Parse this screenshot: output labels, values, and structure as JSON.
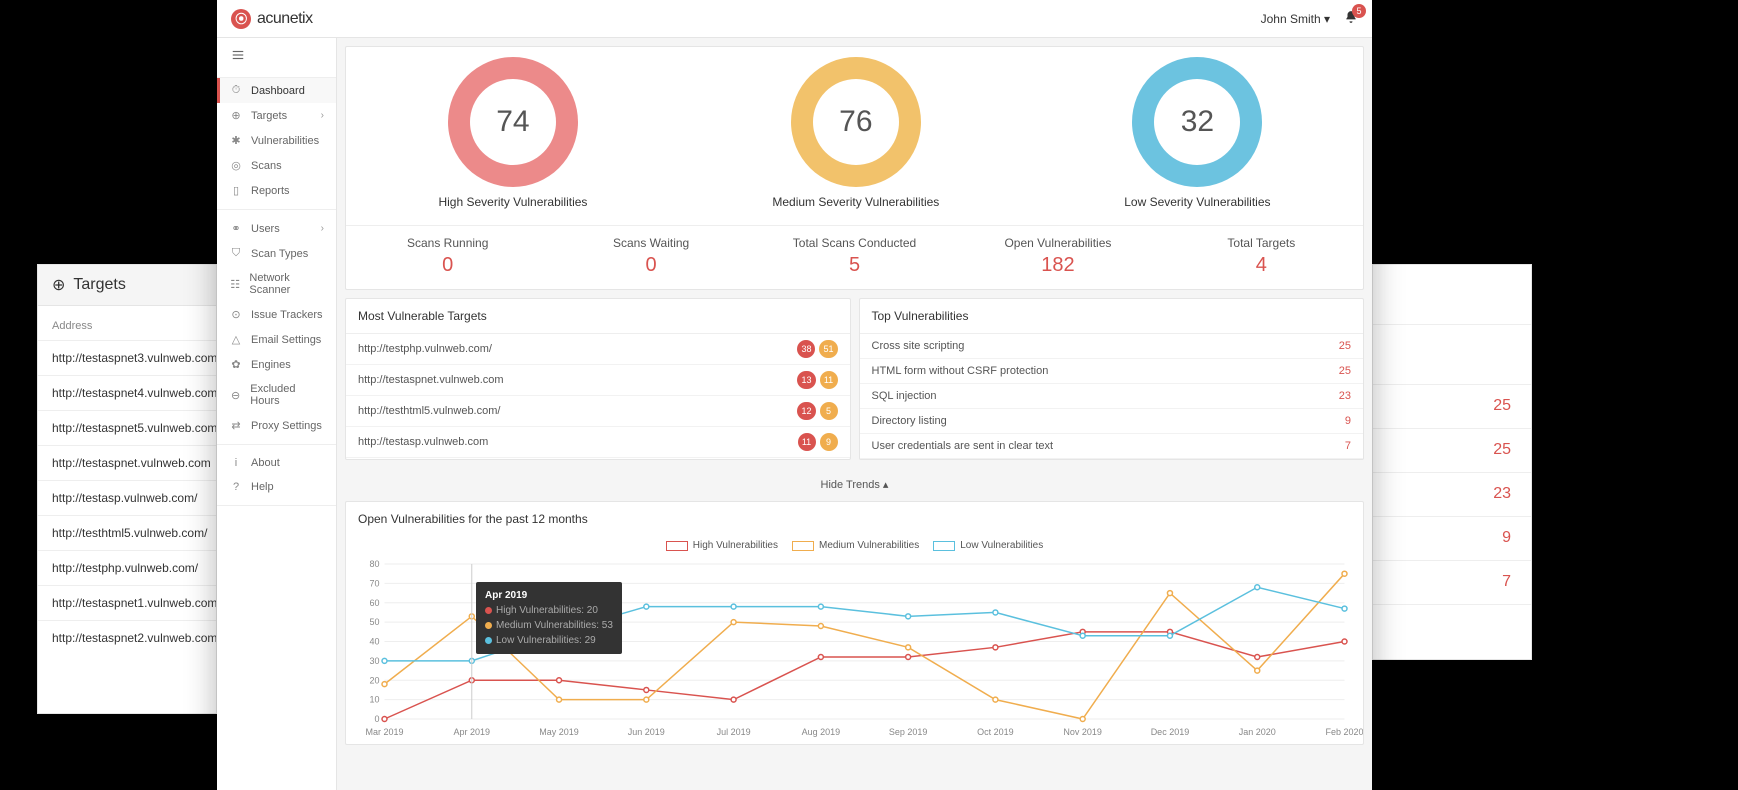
{
  "brand": "acunetix",
  "user": {
    "name": "John Smith",
    "notifications": 5
  },
  "sidebar": {
    "groups": [
      {
        "items": [
          {
            "icon": "⏱",
            "label": "Dashboard",
            "active": true
          },
          {
            "icon": "⊕",
            "label": "Targets",
            "chevron": true
          },
          {
            "icon": "✱",
            "label": "Vulnerabilities"
          },
          {
            "icon": "◎",
            "label": "Scans"
          },
          {
            "icon": "▯",
            "label": "Reports"
          }
        ]
      },
      {
        "items": [
          {
            "icon": "⚭",
            "label": "Users",
            "chevron": true
          },
          {
            "icon": "⛉",
            "label": "Scan Types"
          },
          {
            "icon": "☷",
            "label": "Network Scanner"
          },
          {
            "icon": "⊙",
            "label": "Issue Trackers"
          },
          {
            "icon": "△",
            "label": "Email Settings"
          },
          {
            "icon": "✿",
            "label": "Engines"
          },
          {
            "icon": "⊖",
            "label": "Excluded Hours"
          },
          {
            "icon": "⇄",
            "label": "Proxy Settings"
          }
        ]
      },
      {
        "items": [
          {
            "icon": "i",
            "label": "About"
          },
          {
            "icon": "?",
            "label": "Help"
          }
        ]
      }
    ]
  },
  "donuts": [
    {
      "value": 74,
      "label": "High Severity Vulnerabilities",
      "color": "#ec8a8a"
    },
    {
      "value": 76,
      "label": "Medium Severity Vulnerabilities",
      "color": "#f2c26b"
    },
    {
      "value": 32,
      "label": "Low Severity Vulnerabilities",
      "color": "#6cc3e0"
    }
  ],
  "stats": [
    {
      "label": "Scans Running",
      "value": "0"
    },
    {
      "label": "Scans Waiting",
      "value": "0"
    },
    {
      "label": "Total Scans Conducted",
      "value": "5"
    },
    {
      "label": "Open Vulnerabilities",
      "value": "182"
    },
    {
      "label": "Total Targets",
      "value": "4"
    }
  ],
  "mvt": {
    "title": "Most Vulnerable Targets",
    "rows": [
      {
        "url": "http://testphp.vulnweb.com/",
        "high": 38,
        "med": 51
      },
      {
        "url": "http://testaspnet.vulnweb.com",
        "high": 13,
        "med": 11
      },
      {
        "url": "http://testhtml5.vulnweb.com/",
        "high": 12,
        "med": 5
      },
      {
        "url": "http://testasp.vulnweb.com",
        "high": 11,
        "med": 9
      }
    ]
  },
  "topvuln": {
    "title": "Top Vulnerabilities",
    "rows": [
      {
        "name": "Cross site scripting",
        "count": 25
      },
      {
        "name": "HTML form without CSRF protection",
        "count": 25
      },
      {
        "name": "SQL injection",
        "count": 23
      },
      {
        "name": "Directory listing",
        "count": 9
      },
      {
        "name": "User credentials are sent in clear text",
        "count": 7
      }
    ]
  },
  "hide_trends": "Hide Trends",
  "chart": {
    "title": "Open Vulnerabilities for the past 12 months",
    "legend": [
      "High Vulnerabilities",
      "Medium Vulnerabilities",
      "Low Vulnerabilities"
    ],
    "tooltip": {
      "title": "Apr 2019",
      "lines": [
        {
          "color": "#d9534f",
          "text": "High Vulnerabilities: 20"
        },
        {
          "color": "#f0ad4e",
          "text": "Medium Vulnerabilities: 53"
        },
        {
          "color": "#5bc0de",
          "text": "Low Vulnerabilities: 29"
        }
      ]
    }
  },
  "chart_data": {
    "type": "line",
    "categories": [
      "Mar 2019",
      "Apr 2019",
      "May 2019",
      "Jun 2019",
      "Jul 2019",
      "Aug 2019",
      "Sep 2019",
      "Oct 2019",
      "Nov 2019",
      "Dec 2019",
      "Jan 2020",
      "Feb 2020"
    ],
    "series": [
      {
        "name": "High Vulnerabilities",
        "color": "#d9534f",
        "values": [
          0,
          20,
          20,
          15,
          10,
          32,
          32,
          37,
          45,
          45,
          32,
          40
        ]
      },
      {
        "name": "Medium Vulnerabilities",
        "color": "#f0ad4e",
        "values": [
          18,
          53,
          10,
          10,
          50,
          48,
          37,
          10,
          0,
          65,
          25,
          75
        ]
      },
      {
        "name": "Low Vulnerabilities",
        "color": "#5bc0de",
        "values": [
          30,
          30,
          45,
          58,
          58,
          58,
          53,
          55,
          43,
          43,
          68,
          57
        ]
      }
    ],
    "ylim": [
      0,
      80
    ],
    "yticks": [
      0,
      10,
      20,
      30,
      40,
      50,
      60,
      70,
      80
    ]
  },
  "back_left": {
    "title": "Targets",
    "subheader": "Address",
    "rows": [
      "http://testaspnet3.vulnweb.com",
      "http://testaspnet4.vulnweb.com",
      "http://testaspnet5.vulnweb.com",
      "http://testaspnet.vulnweb.com",
      "http://testasp.vulnweb.com/",
      "http://testhtml5.vulnweb.com/",
      "http://testphp.vulnweb.com/",
      "http://testaspnet1.vulnweb.com",
      "http://testaspnet2.vulnweb.com"
    ]
  },
  "back_right": {
    "rows": [
      "25",
      "25",
      "23",
      "9",
      "7"
    ]
  }
}
